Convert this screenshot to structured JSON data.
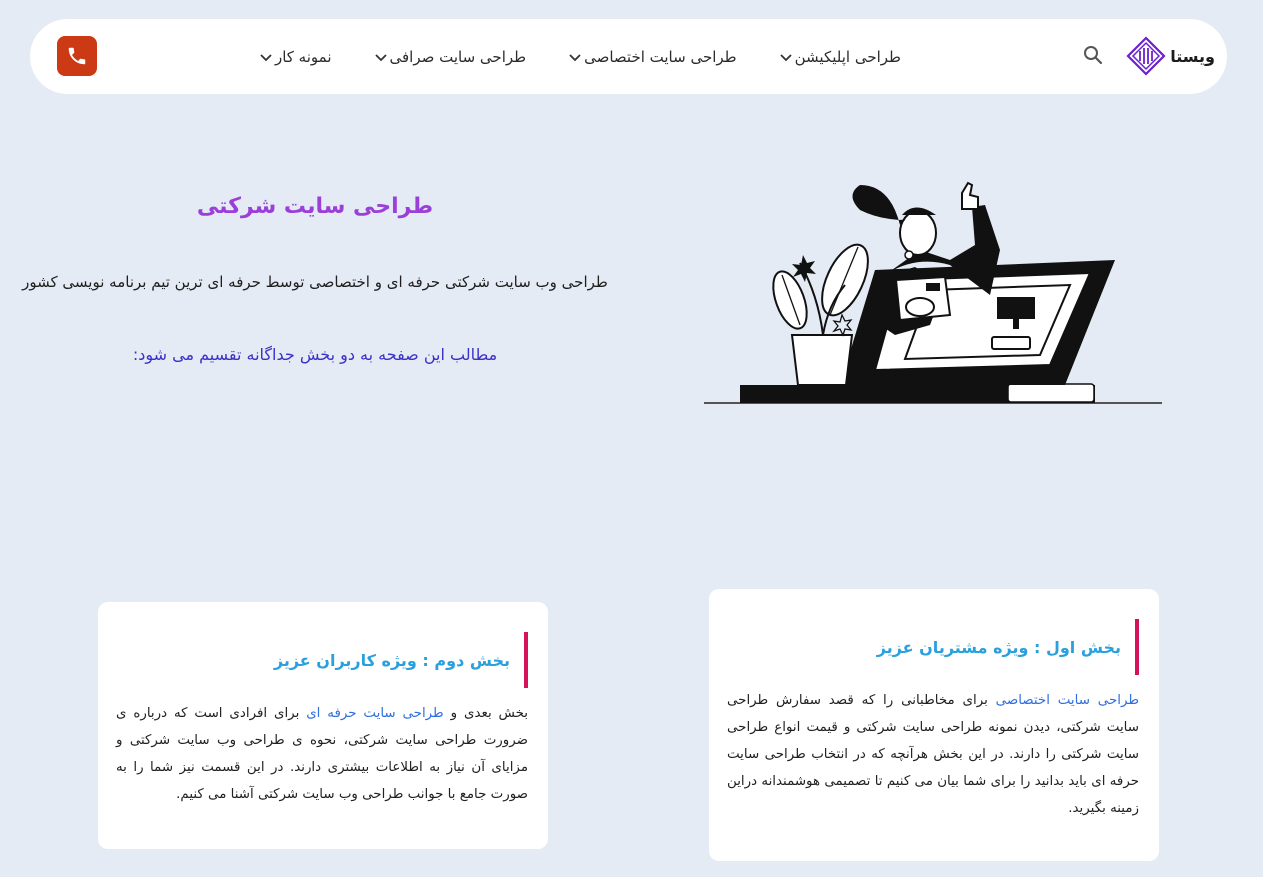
{
  "header": {
    "logo_text": "ویستا",
    "nav": [
      {
        "label": "طراحی اپلیکیشن"
      },
      {
        "label": "طراحی سایت اختصاصی"
      },
      {
        "label": "طراحی سایت صرافی"
      },
      {
        "label": "نمونه کار"
      }
    ],
    "icons": {
      "search": "search-icon",
      "phone": "phone-icon",
      "chevron": "chevron-down-icon"
    },
    "phone_color": "#cc3915"
  },
  "hero": {
    "title": "طراحی سایت شرکتی",
    "subtitle": "طراحی وب سایت شرکتی حرفه ای و اختصاصی توسط حرفه ای ترین تیم برنامه نویسی کشور",
    "note": "مطالب این صفحه به دو بخش جداگانه تقسیم می شود:",
    "title_color": "#9b3fd9"
  },
  "cards": [
    {
      "title": "بخش اول : ویژه مشتریان عزیز",
      "link": "طراحی سایت اختصاصی",
      "text": " برای مخاطبانی را که قصد سفارش طراحی سایت شرکتی، دیدن نمونه طراحی سایت شرکتی و قیمت انواع طراحی سایت شرکتی را دارند. در این بخش هرآنچه که در انتخاب طراحی سایت حرفه ای باید بدانید را برای شما بیان می کنیم تا تصمیمی هوشمندانه دراین زمینه بگیرید."
    },
    {
      "title": "بخش دوم : ویژه کاربران عزیز",
      "text_before": "بخش بعدی و ",
      "link": "طراحی سایت حرفه ای",
      "text": " برای افرادی است که درباره ی ضرورت طراحی سایت شرکتی، نحوه ی طراحی وب سایت شرکتی و مزایای آن نیاز به اطلاعات بیشتری دارند. در این قسمت نیز شما را به صورت جامع با جوانب طراحی وب سایت شرکتی آشنا می کنیم."
    }
  ],
  "accent_colors": {
    "bar": "#d4135a",
    "card_title": "#2aa0dc",
    "link": "#2f6fe0"
  }
}
